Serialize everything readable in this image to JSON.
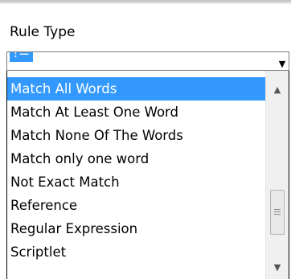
{
  "field": {
    "label": "Rule Type"
  },
  "select": {
    "current_value": "!=",
    "arrow_icon": "chevron-down-icon"
  },
  "dropdown": {
    "items": [
      {
        "label": "Match All Words",
        "selected": true
      },
      {
        "label": "Match At Least One Word",
        "selected": false
      },
      {
        "label": "Match None Of The Words",
        "selected": false
      },
      {
        "label": "Match only one word",
        "selected": false
      },
      {
        "label": "Not Exact Match",
        "selected": false
      },
      {
        "label": "Reference",
        "selected": false
      },
      {
        "label": "Regular Expression",
        "selected": false
      },
      {
        "label": "Scriptlet",
        "selected": false
      }
    ]
  },
  "scrollbar": {
    "up_icon": "scroll-up-arrow-icon",
    "down_icon": "scroll-down-arrow-icon",
    "thumb_icon": "scroll-thumb-grip-icon",
    "scroll_fraction": 0.78
  },
  "colors": {
    "selection_bg": "#3399ff",
    "selection_text": "#ffffff",
    "text": "#000000",
    "scrollbar_track": "#f0f0f0"
  }
}
